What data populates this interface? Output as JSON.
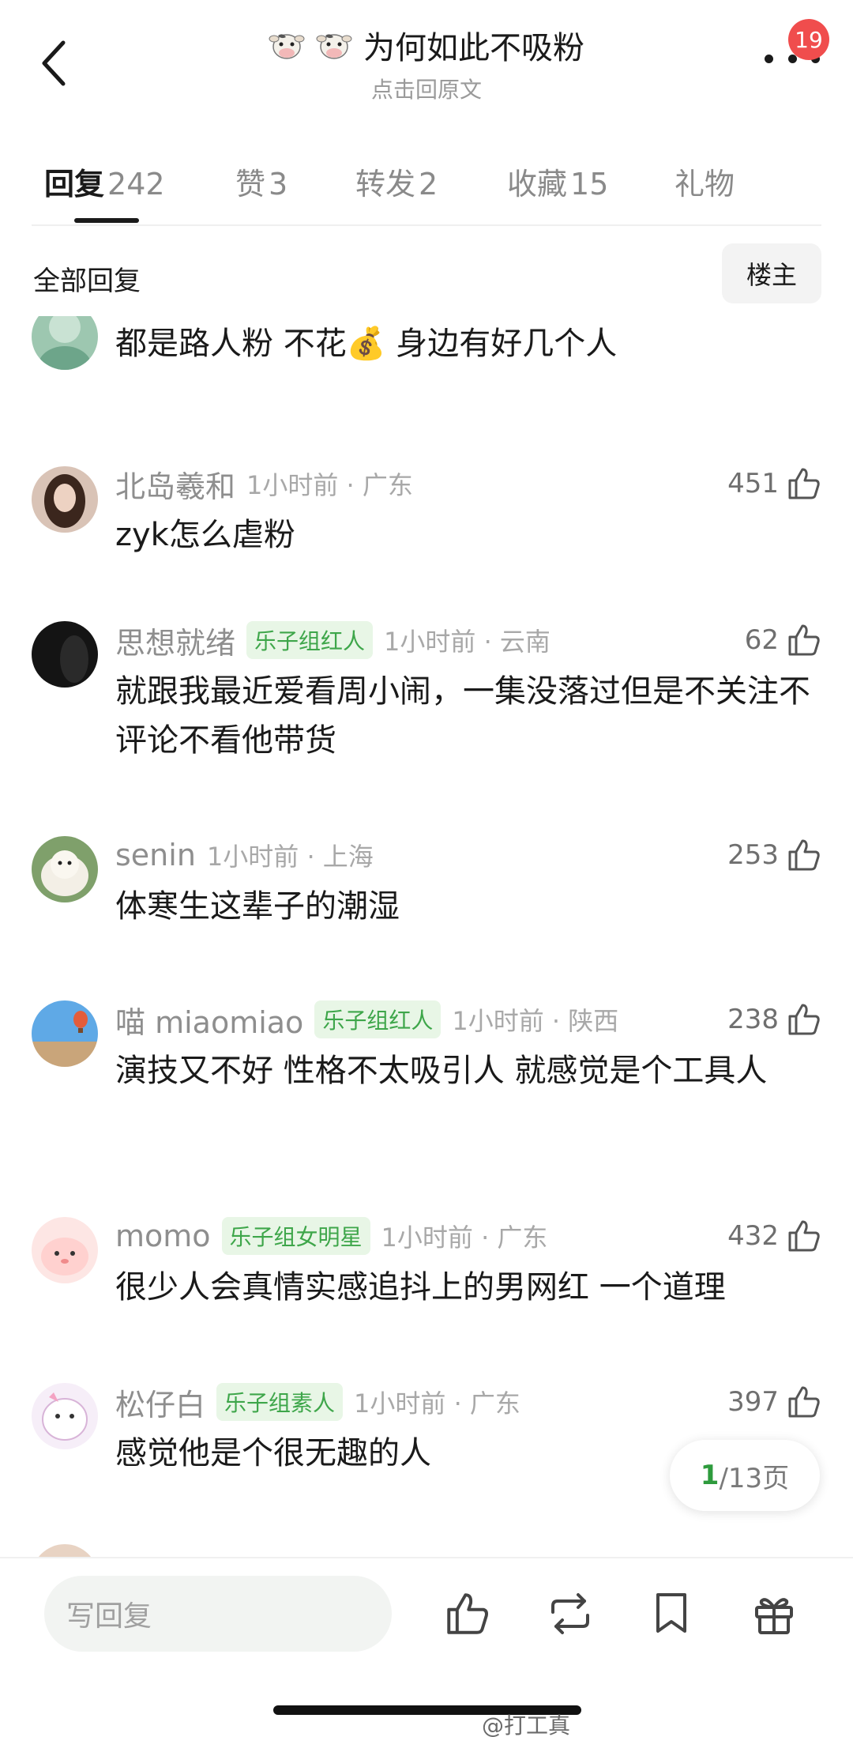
{
  "header": {
    "title": "为何如此不吸粉",
    "subtitle": "点击回原文",
    "badge_count": "19"
  },
  "tabs": [
    {
      "label": "回复",
      "count": "242"
    },
    {
      "label": "赞",
      "count": "3"
    },
    {
      "label": "转发",
      "count": "2"
    },
    {
      "label": "收藏",
      "count": "15"
    },
    {
      "label": "礼物",
      "count": ""
    }
  ],
  "subheader": {
    "all_replies": "全部回复",
    "op_filter": "楼主"
  },
  "comments": [
    {
      "name": "",
      "tag": "",
      "meta": "",
      "likes": "",
      "text": "都是路人粉 不花💰 身边有好几个人"
    },
    {
      "name": "北岛羲和",
      "tag": "",
      "meta": "1小时前 · 广东",
      "likes": "451",
      "text": "zyk怎么虐粉"
    },
    {
      "name": "思想就绪",
      "tag": "乐子组红人",
      "meta": "1小时前 · 云南",
      "likes": "62",
      "text": "就跟我最近爱看周小闹，一集没落过但是不关注不评论不看他带货"
    },
    {
      "name": "senin",
      "tag": "",
      "meta": "1小时前 · 上海",
      "likes": "253",
      "text": "体寒生这辈子的潮湿"
    },
    {
      "name": "喵 miaomiao",
      "tag": "乐子组红人",
      "meta": "1小时前 · 陕西",
      "likes": "238",
      "text": "演技又不好 性格不太吸引人 就感觉是个工具人"
    },
    {
      "name": "momo",
      "tag": "乐子组女明星",
      "meta": "1小时前 · 广东",
      "likes": "432",
      "text": "很少人会真情实感追抖上的男网红 一个道理"
    },
    {
      "name": "松仔白",
      "tag": "乐子组素人",
      "meta": "1小时前 · 广东",
      "likes": "397",
      "text": "感觉他是个很无趣的人"
    }
  ],
  "pager": {
    "current": "1",
    "total_label": "/13页"
  },
  "bottom": {
    "reply_placeholder": "写回复"
  },
  "watermark": "@打工真",
  "colors": {
    "accent_green": "#3ea64a",
    "tag_bg": "#e8f6e6",
    "badge_red": "#f04d4d"
  }
}
